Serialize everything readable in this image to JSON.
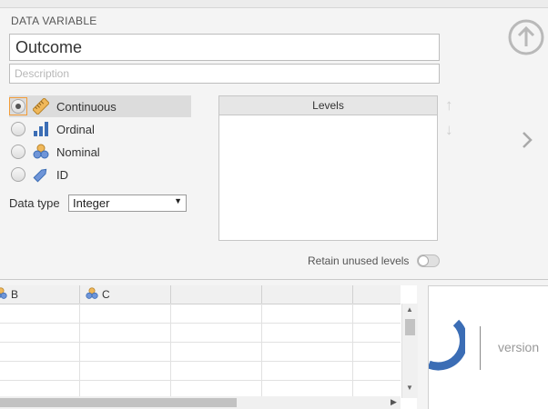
{
  "variable": {
    "section_label": "DATA VARIABLE",
    "name": "Outcome",
    "description_placeholder": "Description"
  },
  "measure_types": [
    {
      "label": "Continuous",
      "icon": "ruler-icon",
      "selected": true
    },
    {
      "label": "Ordinal",
      "icon": "bar-chart-icon",
      "selected": false
    },
    {
      "label": "Nominal",
      "icon": "circles-icon",
      "selected": false
    },
    {
      "label": "ID",
      "icon": "tag-icon",
      "selected": false
    }
  ],
  "data_type": {
    "label": "Data type",
    "value": "Integer"
  },
  "levels": {
    "header": "Levels"
  },
  "retain": {
    "label": "Retain unused levels",
    "on": false
  },
  "sheet": {
    "columns": [
      "B",
      "C"
    ]
  },
  "info": {
    "version_text": "version"
  },
  "colors": {
    "accent_orange": "#f29c38",
    "nav_grey": "#a9a9a9",
    "icon_blue": "#3b6db5"
  }
}
